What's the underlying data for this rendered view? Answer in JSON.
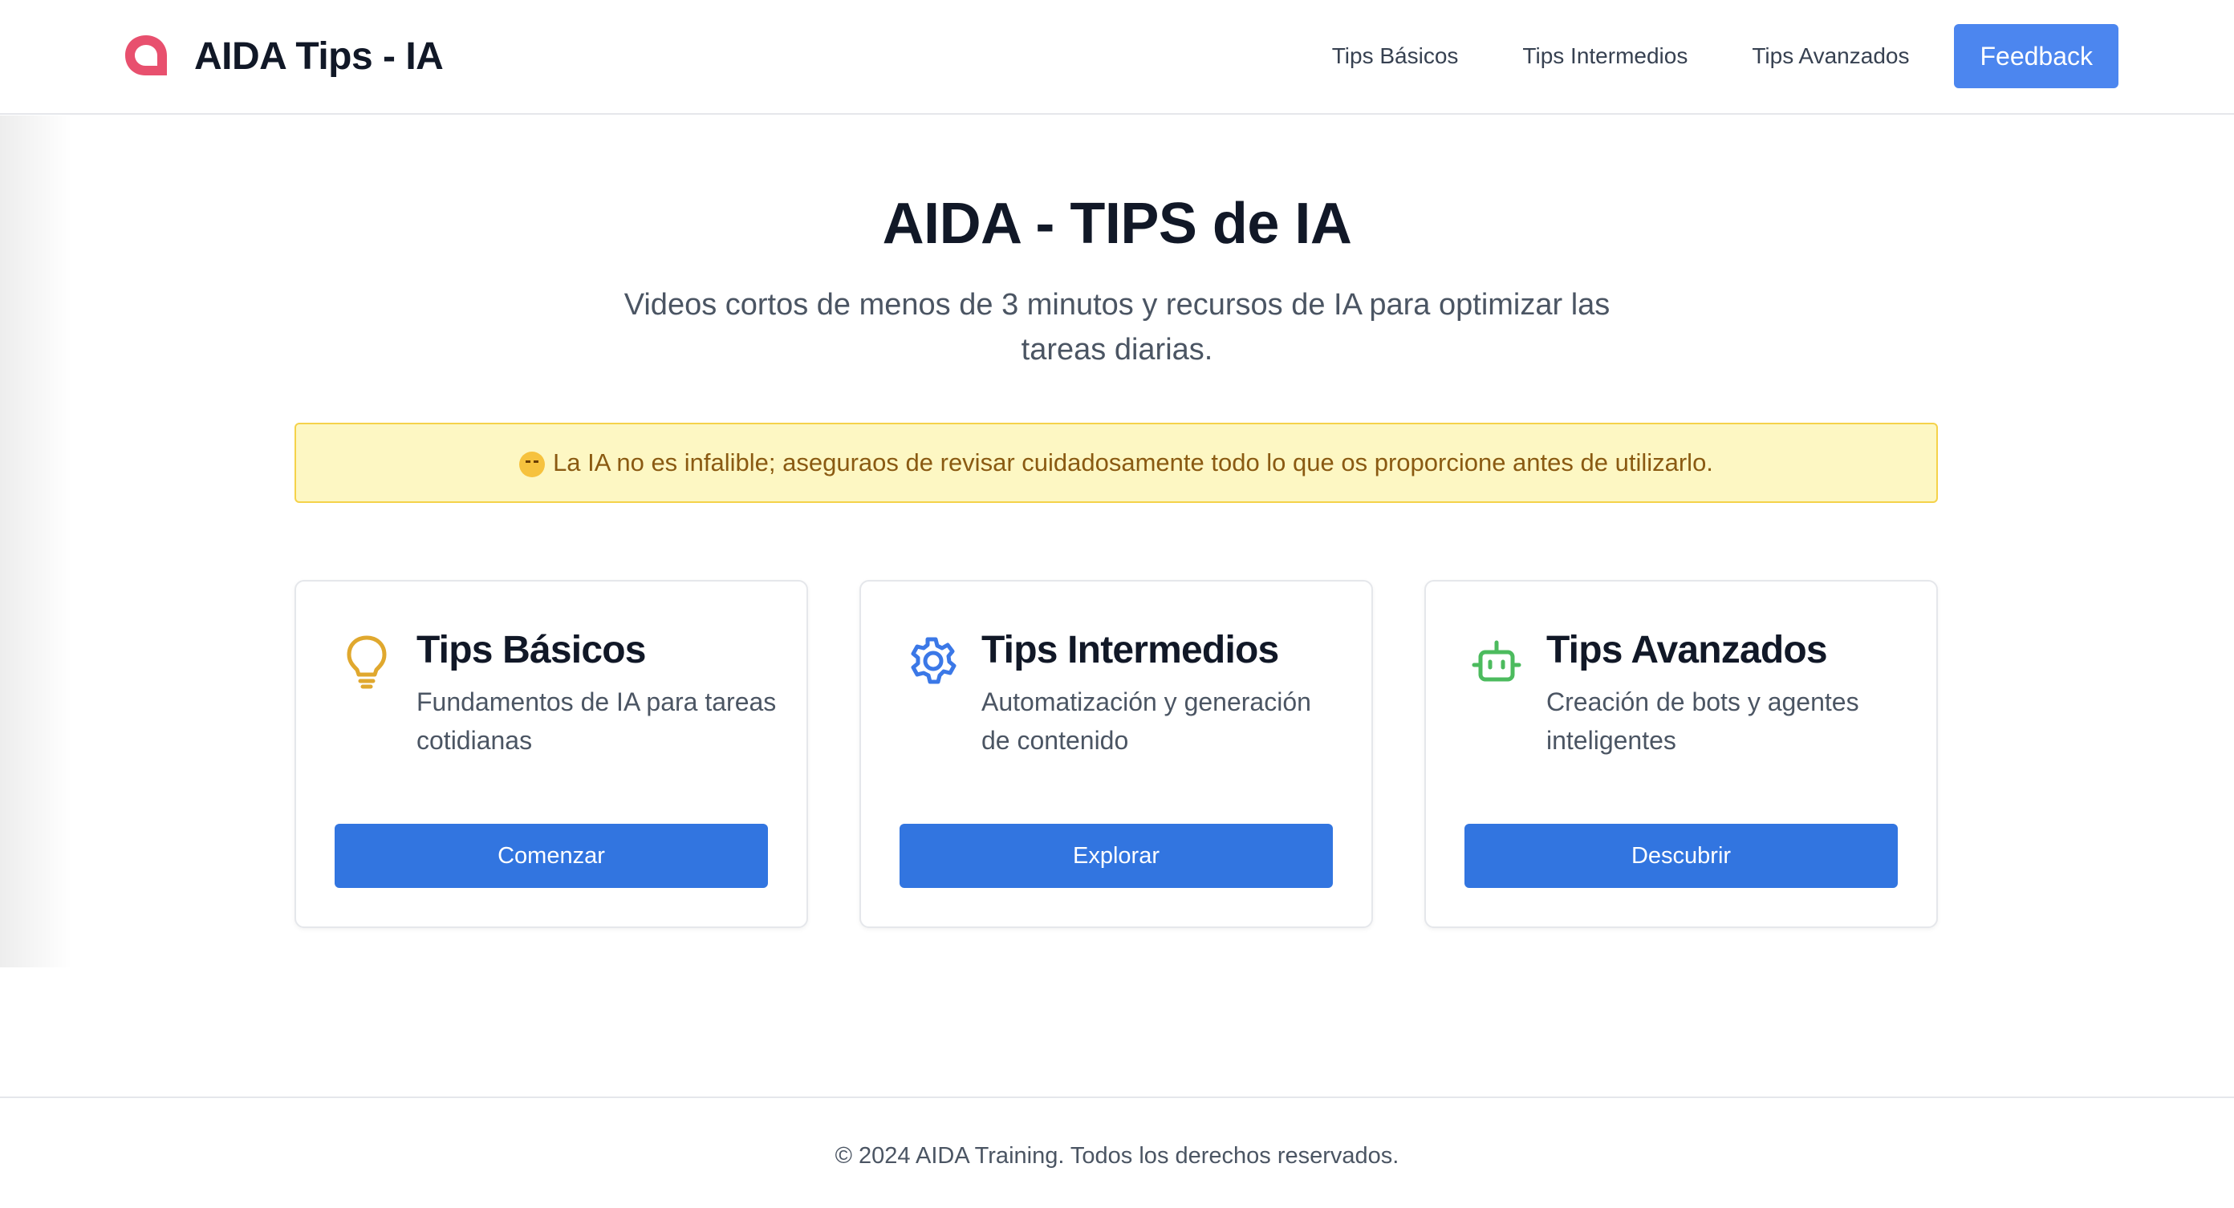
{
  "header": {
    "brand_title": "AIDA Tips - IA",
    "nav": [
      {
        "label": "Tips Básicos"
      },
      {
        "label": "Tips Intermedios"
      },
      {
        "label": "Tips Avanzados"
      }
    ],
    "feedback_label": "Feedback"
  },
  "hero": {
    "title": "AIDA - TIPS de IA",
    "subtitle": "Videos cortos de menos de 3 minutos y recursos de IA para optimizar las tareas diarias."
  },
  "alert": {
    "icon": "winking-face-emoji",
    "text": "La IA no es infalible; aseguraos de revisar cuidadosamente todo lo que os proporcione antes de utilizarlo."
  },
  "cards": [
    {
      "icon": "lightbulb-icon",
      "icon_color": "#e0a82e",
      "title": "Tips Básicos",
      "description": "Fundamentos de IA para tareas cotidianas",
      "button_label": "Comenzar"
    },
    {
      "icon": "gear-icon",
      "icon_color": "#3b78e7",
      "title": "Tips Intermedios",
      "description": "Automatización y generación de contenido",
      "button_label": "Explorar"
    },
    {
      "icon": "robot-icon",
      "icon_color": "#4cbb5e",
      "title": "Tips Avanzados",
      "description": "Creación de bots y agentes inteligentes",
      "button_label": "Descubrir"
    }
  ],
  "footer": {
    "text": "© 2024 AIDA Training. Todos los derechos reservados."
  },
  "colors": {
    "brand_logo": "#e8506e",
    "primary_button": "#3275e0",
    "feedback_button": "#4c86ef",
    "alert_background": "#fdf7c3",
    "alert_border": "#f5d24a",
    "alert_text": "#8a5a12"
  }
}
